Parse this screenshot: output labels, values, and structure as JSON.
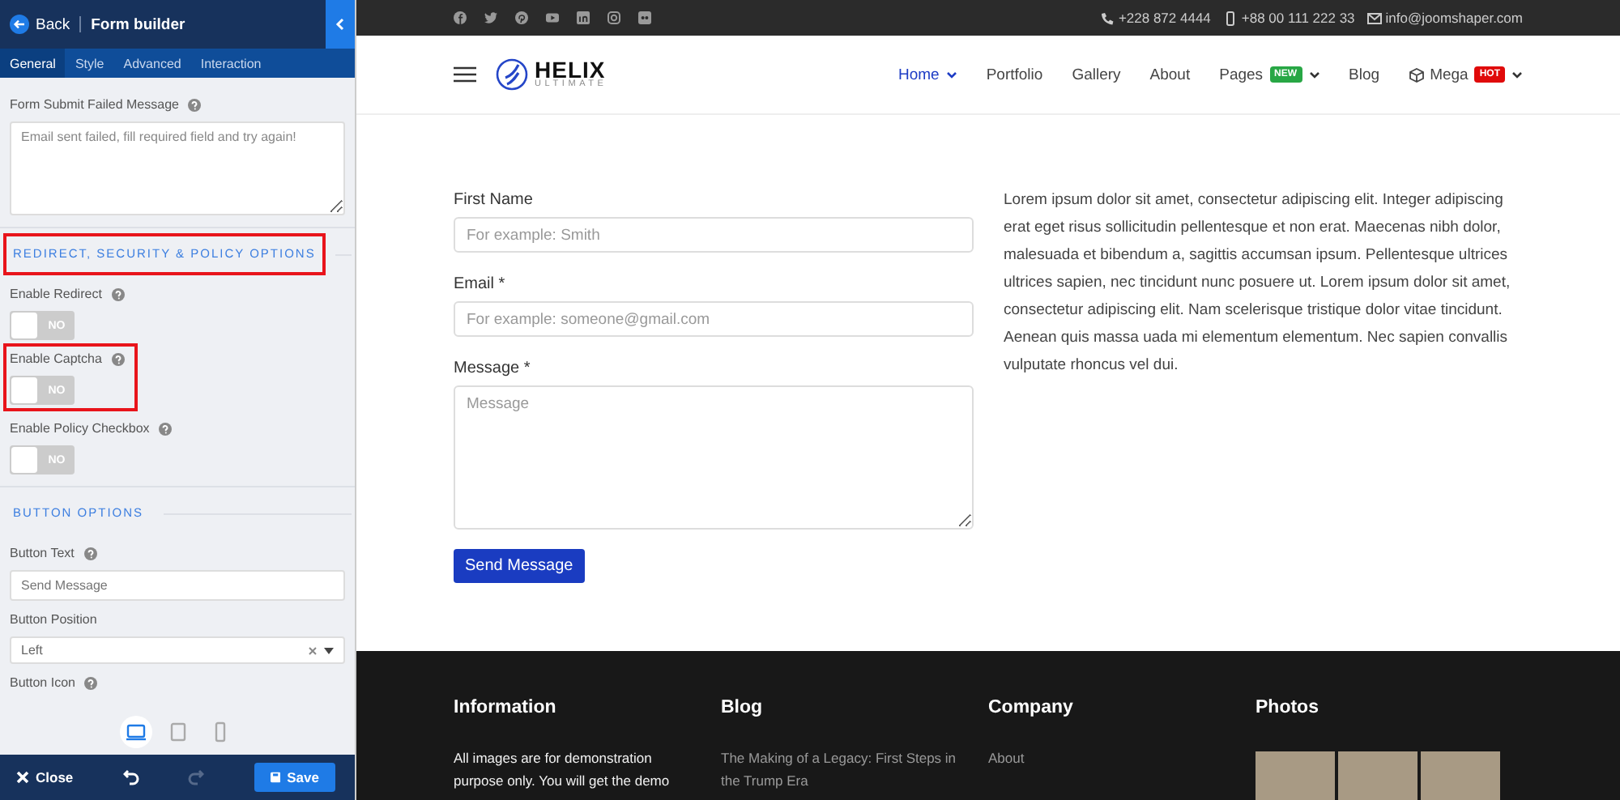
{
  "panel": {
    "back": "Back",
    "title": "Form builder",
    "tabs": [
      {
        "label": "General",
        "selected": true
      },
      {
        "label": "Style",
        "selected": false
      },
      {
        "label": "Advanced",
        "selected": false
      },
      {
        "label": "Interaction",
        "selected": false
      }
    ],
    "items": [
      {
        "kind": "textarea",
        "label": "Form Submit Failed Message",
        "help": true,
        "highlighted": false,
        "value": "Email sent failed, fill required field and try again!"
      },
      {
        "kind": "heading",
        "label": "REDIRECT, SECURITY & POLICY OPTIONS",
        "highlighted": true
      },
      {
        "kind": "toggle",
        "label": "Enable Redirect",
        "help": true,
        "highlighted": false,
        "on": false,
        "state_label": "NO"
      },
      {
        "kind": "toggle",
        "label": "Enable Captcha",
        "help": true,
        "highlighted": true,
        "on": false,
        "state_label": "NO"
      },
      {
        "kind": "toggle",
        "label": "Enable Policy Checkbox",
        "help": true,
        "highlighted": false,
        "on": false,
        "state_label": "NO"
      },
      {
        "kind": "heading",
        "label": "BUTTON OPTIONS",
        "highlighted": false
      },
      {
        "kind": "text",
        "label": "Button Text",
        "help": true,
        "highlighted": false,
        "placeholder": "Send Message"
      },
      {
        "kind": "select",
        "label": "Button Position",
        "help": false,
        "highlighted": false,
        "value": "Left"
      },
      {
        "kind": "label",
        "label": "Button Icon",
        "help": true,
        "highlighted": false
      }
    ],
    "devices": [
      {
        "kind": "desktop",
        "selected": true
      },
      {
        "kind": "tablet",
        "selected": false
      },
      {
        "kind": "mobile",
        "selected": false
      }
    ],
    "close": "Close",
    "save": "Save"
  },
  "site": {
    "socials": [
      {
        "kind": "facebook"
      },
      {
        "kind": "twitter"
      },
      {
        "kind": "pinterest"
      },
      {
        "kind": "youtube"
      },
      {
        "kind": "linkedin"
      },
      {
        "kind": "instagram"
      },
      {
        "kind": "flickr"
      }
    ],
    "contacts": [
      {
        "kind": "phone",
        "text": "+228 872 4444"
      },
      {
        "kind": "mobile",
        "text": "+88 00 111 222 33"
      },
      {
        "kind": "email",
        "text": "info@joomshaper.com"
      }
    ],
    "logo": {
      "name": "HELIX",
      "tagline": "ULTIMATE"
    },
    "menu": [
      {
        "label": "Home",
        "selected": true,
        "dropdown": true
      },
      {
        "label": "Portfolio",
        "selected": false,
        "dropdown": false
      },
      {
        "label": "Gallery",
        "selected": false,
        "dropdown": false
      },
      {
        "label": "About",
        "selected": false,
        "dropdown": false
      },
      {
        "label": "Pages",
        "selected": false,
        "dropdown": true,
        "badge": {
          "text": "NEW",
          "color": "#28a745"
        }
      },
      {
        "label": "Blog",
        "selected": false,
        "dropdown": false
      },
      {
        "label": "Mega",
        "selected": false,
        "dropdown": true,
        "icon": true,
        "badge": {
          "text": "HOT",
          "color": "#e00a0a"
        }
      }
    ],
    "form": {
      "fields": [
        {
          "kind": "input",
          "label": "First Name",
          "placeholder": "For example: Smith"
        },
        {
          "kind": "input",
          "label": "Email *",
          "placeholder": "For example: someone@gmail.com"
        },
        {
          "kind": "textarea",
          "label": "Message *",
          "placeholder": "Message"
        }
      ],
      "button": "Send Message"
    },
    "text": "Lorem ipsum dolor sit amet, consectetur adipiscing elit. Integer adipiscing erat eget risus sollicitudin pellentesque et non erat. Maecenas nibh dolor, malesuada et bibendum a, sagittis accumsan ipsum. Pellentesque ultrices ultrices sapien, nec tincidunt nunc posuere ut. Lorem ipsum dolor sit amet, consectetur adipiscing elit. Nam scelerisque tristique dolor vitae tincidunt. Aenean quis massa uada mi elementum elementum. Nec sapien convallis vulputate rhoncus vel dui.",
    "footer": [
      {
        "kind": "text",
        "title": "Information",
        "text": "All images are for demonstration purpose only. You will get the demo"
      },
      {
        "kind": "links",
        "title": "Blog",
        "links": [
          "The Making of a Legacy: First Steps in the Trump Era"
        ]
      },
      {
        "kind": "links",
        "title": "Company",
        "links": [
          "About"
        ]
      },
      {
        "kind": "photos",
        "title": "Photos"
      }
    ]
  }
}
